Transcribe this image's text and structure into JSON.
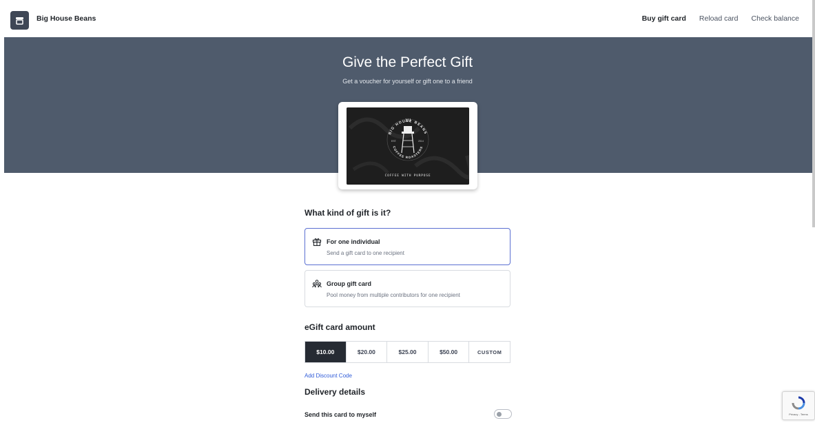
{
  "header": {
    "brand": "Big House Beans",
    "nav": [
      {
        "label": "Buy gift card",
        "active": true
      },
      {
        "label": "Reload card",
        "active": false
      },
      {
        "label": "Check balance",
        "active": false
      }
    ]
  },
  "hero": {
    "title": "Give the Perfect Gift",
    "subtitle": "Get a voucher for yourself or gift one to a friend",
    "card_image": {
      "top_text": "BIG HOUSE BEANS",
      "bottom_text": "COFFEE ROASTERS",
      "est_left": "EST.",
      "est_right": "2014",
      "tagline": "COFFEE WITH PURPOSE"
    }
  },
  "gift_type": {
    "heading": "What kind of gift is it?",
    "options": [
      {
        "title": "For one individual",
        "description": "Send a gift card to one recipient",
        "icon": "gift-icon",
        "selected": true
      },
      {
        "title": "Group gift card",
        "description": "Pool money from multiple contributors for one recipient",
        "icon": "group-icon",
        "selected": false
      }
    ]
  },
  "amount": {
    "heading": "eGift card amount",
    "options": [
      "$10.00",
      "$20.00",
      "$25.00",
      "$50.00",
      "CUSTOM"
    ],
    "selected": "$10.00"
  },
  "discount_link": "Add Discount Code",
  "delivery": {
    "heading": "Delivery details",
    "send_to_myself_label": "Send this card to myself",
    "send_to_myself_on": false
  },
  "recaptcha": {
    "text": "Privacy - Terms"
  },
  "colors": {
    "hero_bg": "#4f5b6c",
    "accent_border": "#5a6fd1",
    "active_amount_bg": "#262b33",
    "link": "#2f5bd8"
  }
}
